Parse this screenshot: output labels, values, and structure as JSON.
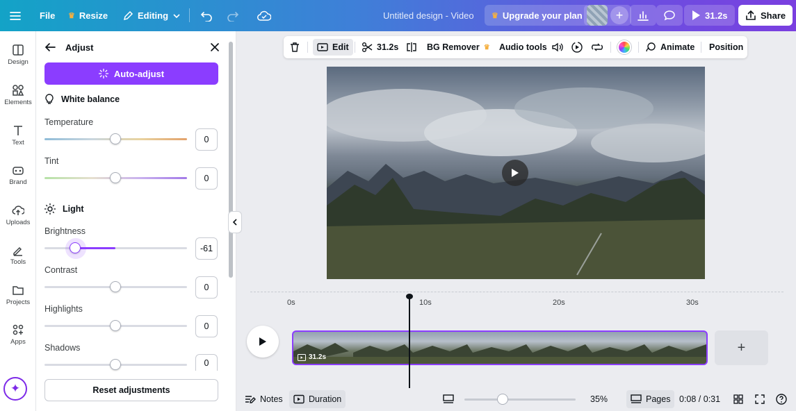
{
  "topbar": {
    "file": "File",
    "resize": "Resize",
    "editing": "Editing",
    "title": "Untitled design - Video",
    "upgrade": "Upgrade your plan",
    "duration": "31.2s",
    "share": "Share"
  },
  "rail": {
    "items": [
      {
        "label": "Design",
        "icon": "design-icon"
      },
      {
        "label": "Elements",
        "icon": "elements-icon"
      },
      {
        "label": "Text",
        "icon": "text-icon"
      },
      {
        "label": "Brand",
        "icon": "brand-icon"
      },
      {
        "label": "Uploads",
        "icon": "uploads-icon"
      },
      {
        "label": "Tools",
        "icon": "tools-icon"
      },
      {
        "label": "Projects",
        "icon": "projects-icon"
      },
      {
        "label": "Apps",
        "icon": "apps-icon"
      }
    ]
  },
  "panel": {
    "title": "Adjust",
    "auto_adjust": "Auto-adjust",
    "white_balance": "White balance",
    "light": "Light",
    "reset": "Reset adjustments",
    "sliders": [
      {
        "label": "Temperature",
        "value": "0",
        "level": 0.5
      },
      {
        "label": "Tint",
        "value": "0",
        "level": 0.5
      },
      {
        "label": "Brightness",
        "value": "-61",
        "level": 0.2
      },
      {
        "label": "Contrast",
        "value": "0",
        "level": 0.5
      },
      {
        "label": "Highlights",
        "value": "0",
        "level": 0.5
      },
      {
        "label": "Shadows",
        "value": "0",
        "level": 0.5
      }
    ]
  },
  "toolbar": {
    "edit": "Edit",
    "duration": "31.2s",
    "bg_remover": "BG Remover",
    "audio_tools": "Audio tools",
    "animate": "Animate",
    "position": "Position"
  },
  "timeline": {
    "ticks": [
      "0s",
      "10s",
      "20s",
      "30s"
    ],
    "clip_duration": "31.2s"
  },
  "bottombar": {
    "notes": "Notes",
    "duration": "Duration",
    "zoom": "35%",
    "zoom_level": 0.35,
    "pages": "Pages",
    "time": "0:08 / 0:31"
  },
  "colors": {
    "accent": "#8b3dff",
    "topbar_start": "#13a3c7",
    "topbar_end": "#7a3fe0"
  }
}
